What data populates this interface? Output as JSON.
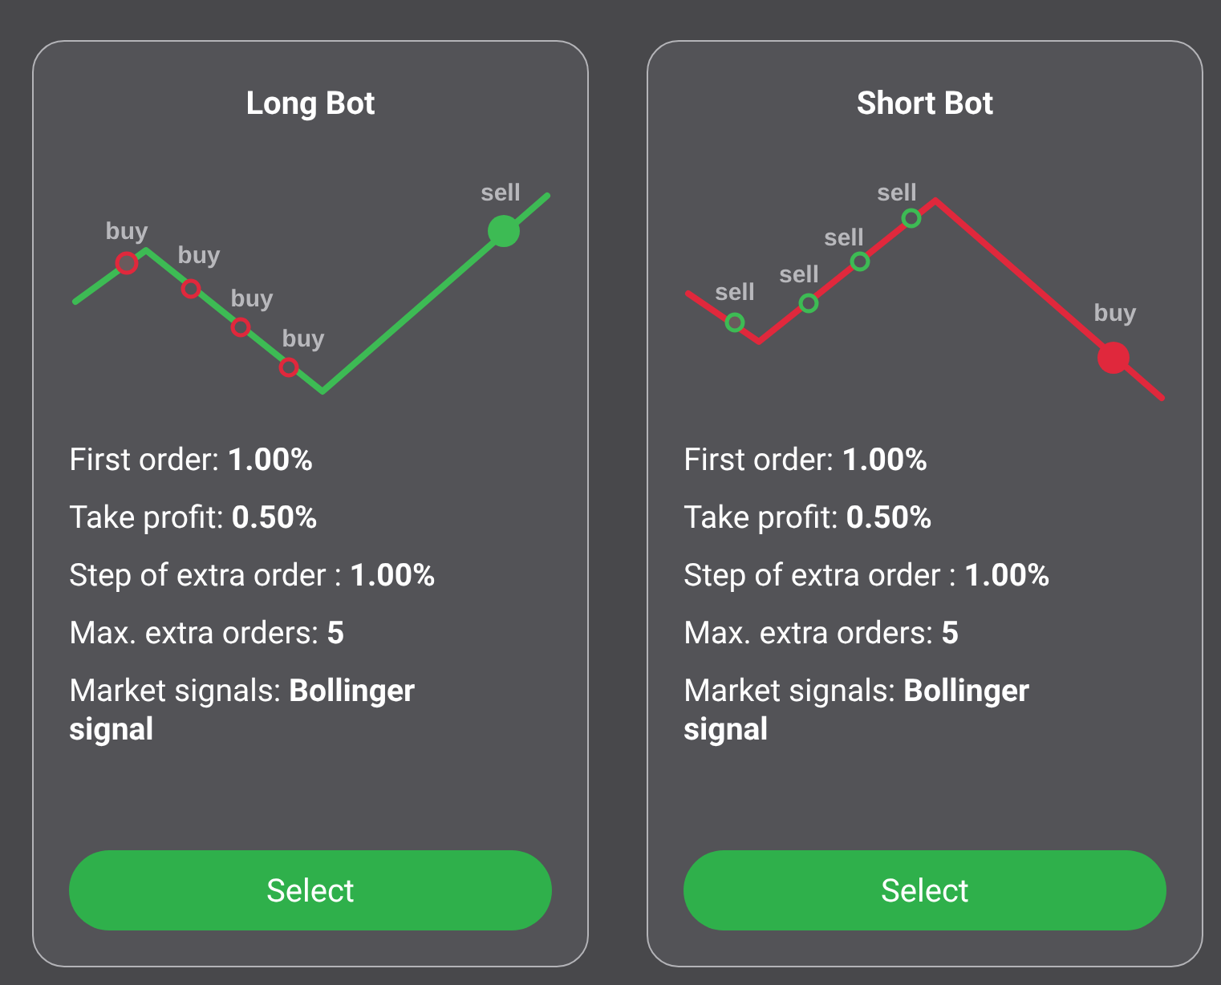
{
  "cards": [
    {
      "kind": "long",
      "title": "Long Bot",
      "markers": [
        {
          "label": "buy",
          "kind": "entry"
        },
        {
          "label": "buy",
          "kind": "entry"
        },
        {
          "label": "buy",
          "kind": "entry"
        },
        {
          "label": "buy",
          "kind": "entry"
        },
        {
          "label": "sell",
          "kind": "exit"
        }
      ],
      "settings": [
        "First order:  **1.00%**",
        "Take profit:  **0.50%**",
        "Step of extra order :  **1.00%**",
        "Max. extra orders:  **5**",
        "Market signals:  **Bollinger signal**"
      ],
      "button": "Select"
    },
    {
      "kind": "short",
      "title": "Short Bot",
      "markers": [
        {
          "label": "sell",
          "kind": "entry"
        },
        {
          "label": "sell",
          "kind": "entry"
        },
        {
          "label": "sell",
          "kind": "entry"
        },
        {
          "label": "sell",
          "kind": "entry"
        },
        {
          "label": "buy",
          "kind": "exit"
        }
      ],
      "settings": [
        "First order:  **1.00%**",
        "Take profit:  **0.50%**",
        "Step of extra order :  **1.00%**",
        "Max. extra orders:  **5**",
        "Market signals:  **Bollinger signal**"
      ],
      "button": "Select"
    }
  ]
}
